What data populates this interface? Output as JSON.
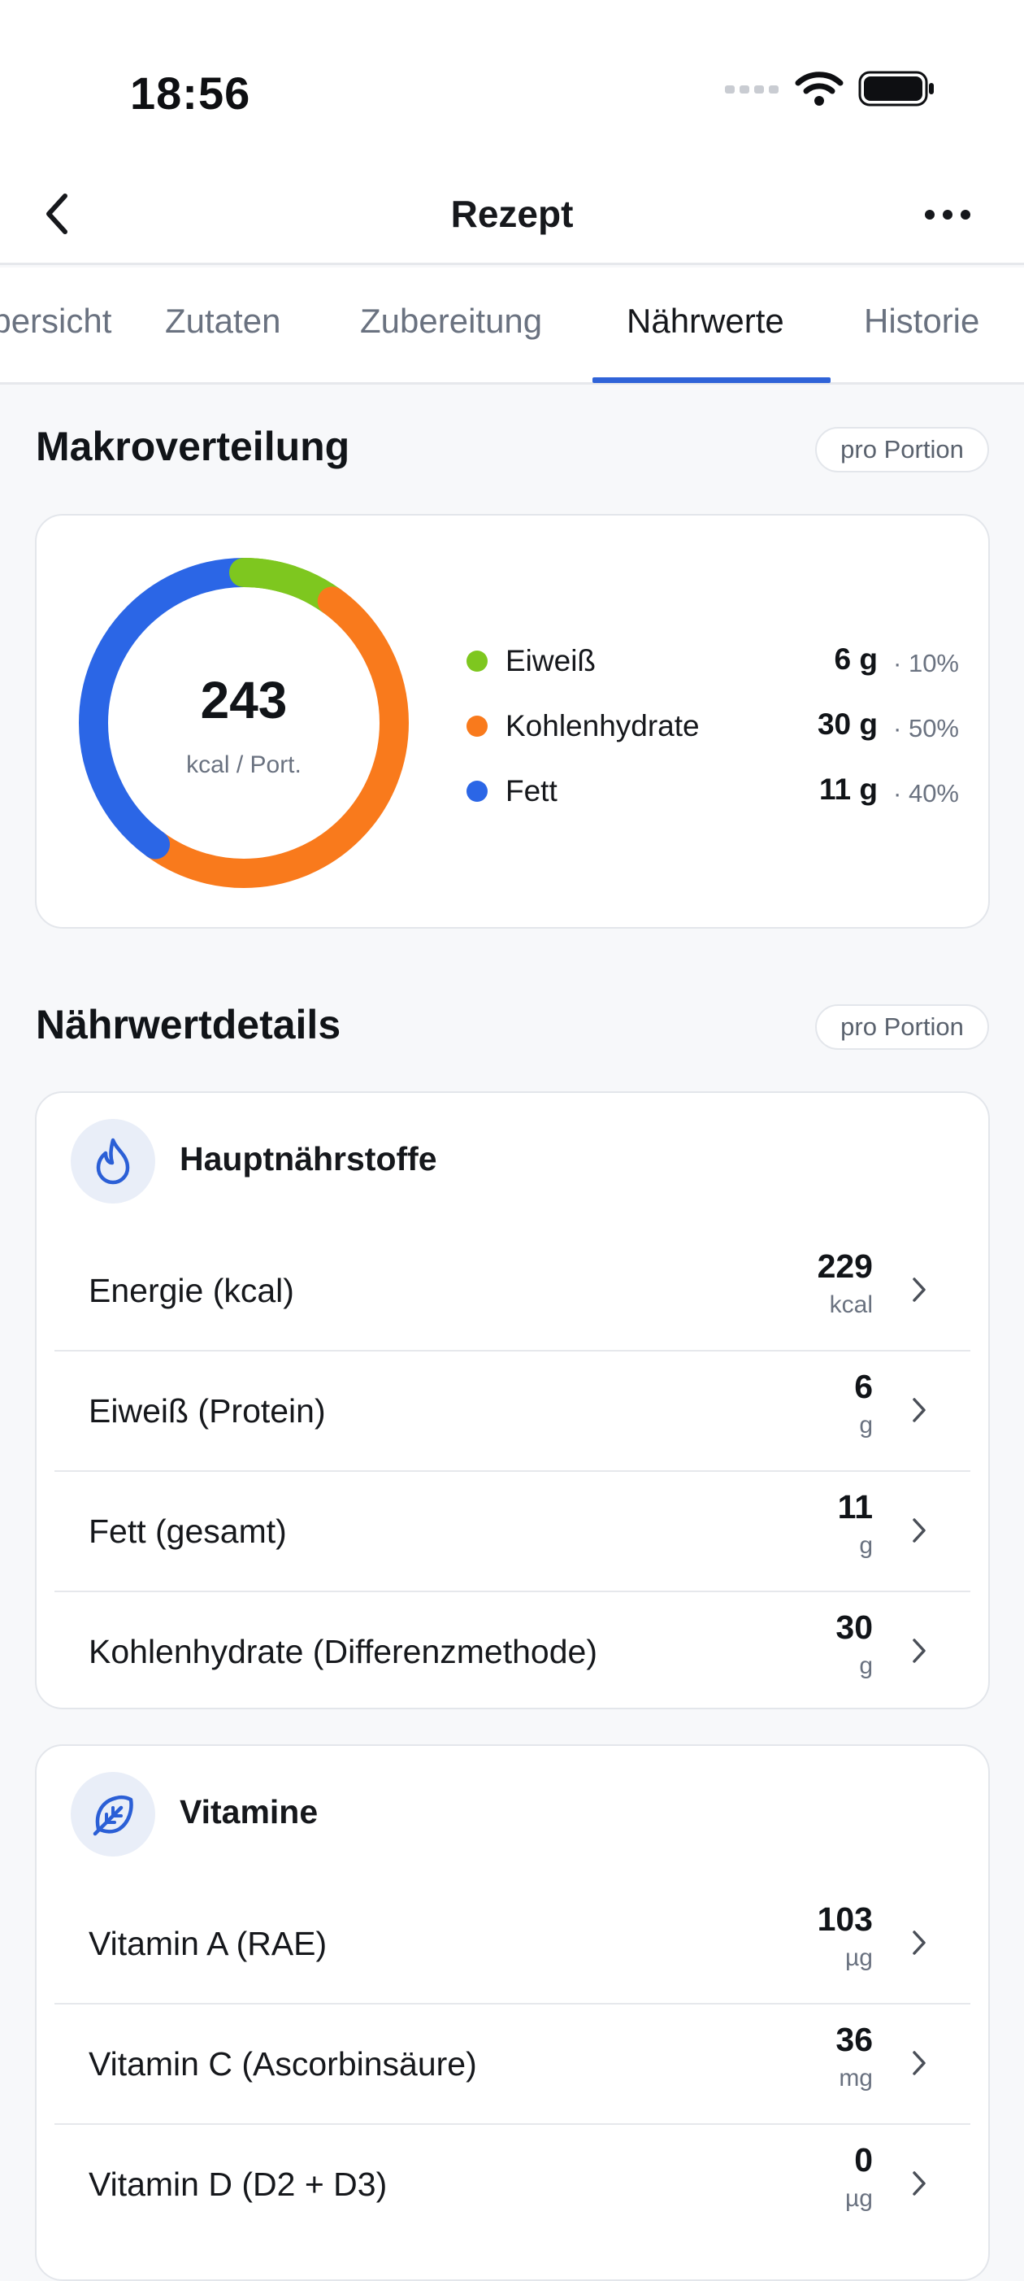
{
  "status": {
    "time": "18:56"
  },
  "nav": {
    "title": "Rezept"
  },
  "tabs": [
    {
      "label": "Übersicht",
      "active": false
    },
    {
      "label": "Zutaten",
      "active": false
    },
    {
      "label": "Zubereitung",
      "active": false
    },
    {
      "label": "Nährwerte",
      "active": true
    },
    {
      "label": "Historie",
      "active": false
    }
  ],
  "macro": {
    "title": "Makroverteilung",
    "pill": "pro Portion",
    "kcal": "243",
    "kcal_unit": "kcal / Port.",
    "items": [
      {
        "label": "Eiweiß",
        "value": "6 g",
        "pct": "· 10%",
        "share": 0.1,
        "color": "#7ec71f"
      },
      {
        "label": "Kohlenhydrate",
        "value": "30 g",
        "pct": "· 50%",
        "share": 0.5,
        "color": "#f97a1c"
      },
      {
        "label": "Fett",
        "value": "11 g",
        "pct": "· 40%",
        "share": 0.4,
        "color": "#2b66e6"
      }
    ]
  },
  "details": {
    "title": "Nährwertdetails",
    "pill": "pro Portion",
    "groups": [
      {
        "title": "Hauptnährstoffe",
        "icon": "flame-icon",
        "rows": [
          {
            "label": "Energie (kcal)",
            "value": "229",
            "unit": "kcal"
          },
          {
            "label": "Eiweiß (Protein)",
            "value": "6",
            "unit": "g"
          },
          {
            "label": "Fett (gesamt)",
            "value": "11",
            "unit": "g"
          },
          {
            "label": "Kohlenhydrate (Differenzmethode)",
            "value": "30",
            "unit": "g"
          }
        ]
      },
      {
        "title": "Vitamine",
        "icon": "leaf-icon",
        "rows": [
          {
            "label": "Vitamin A (RAE)",
            "value": "103",
            "unit": "µg"
          },
          {
            "label": "Vitamin C (Ascorbinsäure)",
            "value": "36",
            "unit": "mg"
          },
          {
            "label": "Vitamin D (D2 + D3)",
            "value": "0",
            "unit": "µg"
          }
        ]
      }
    ]
  }
}
